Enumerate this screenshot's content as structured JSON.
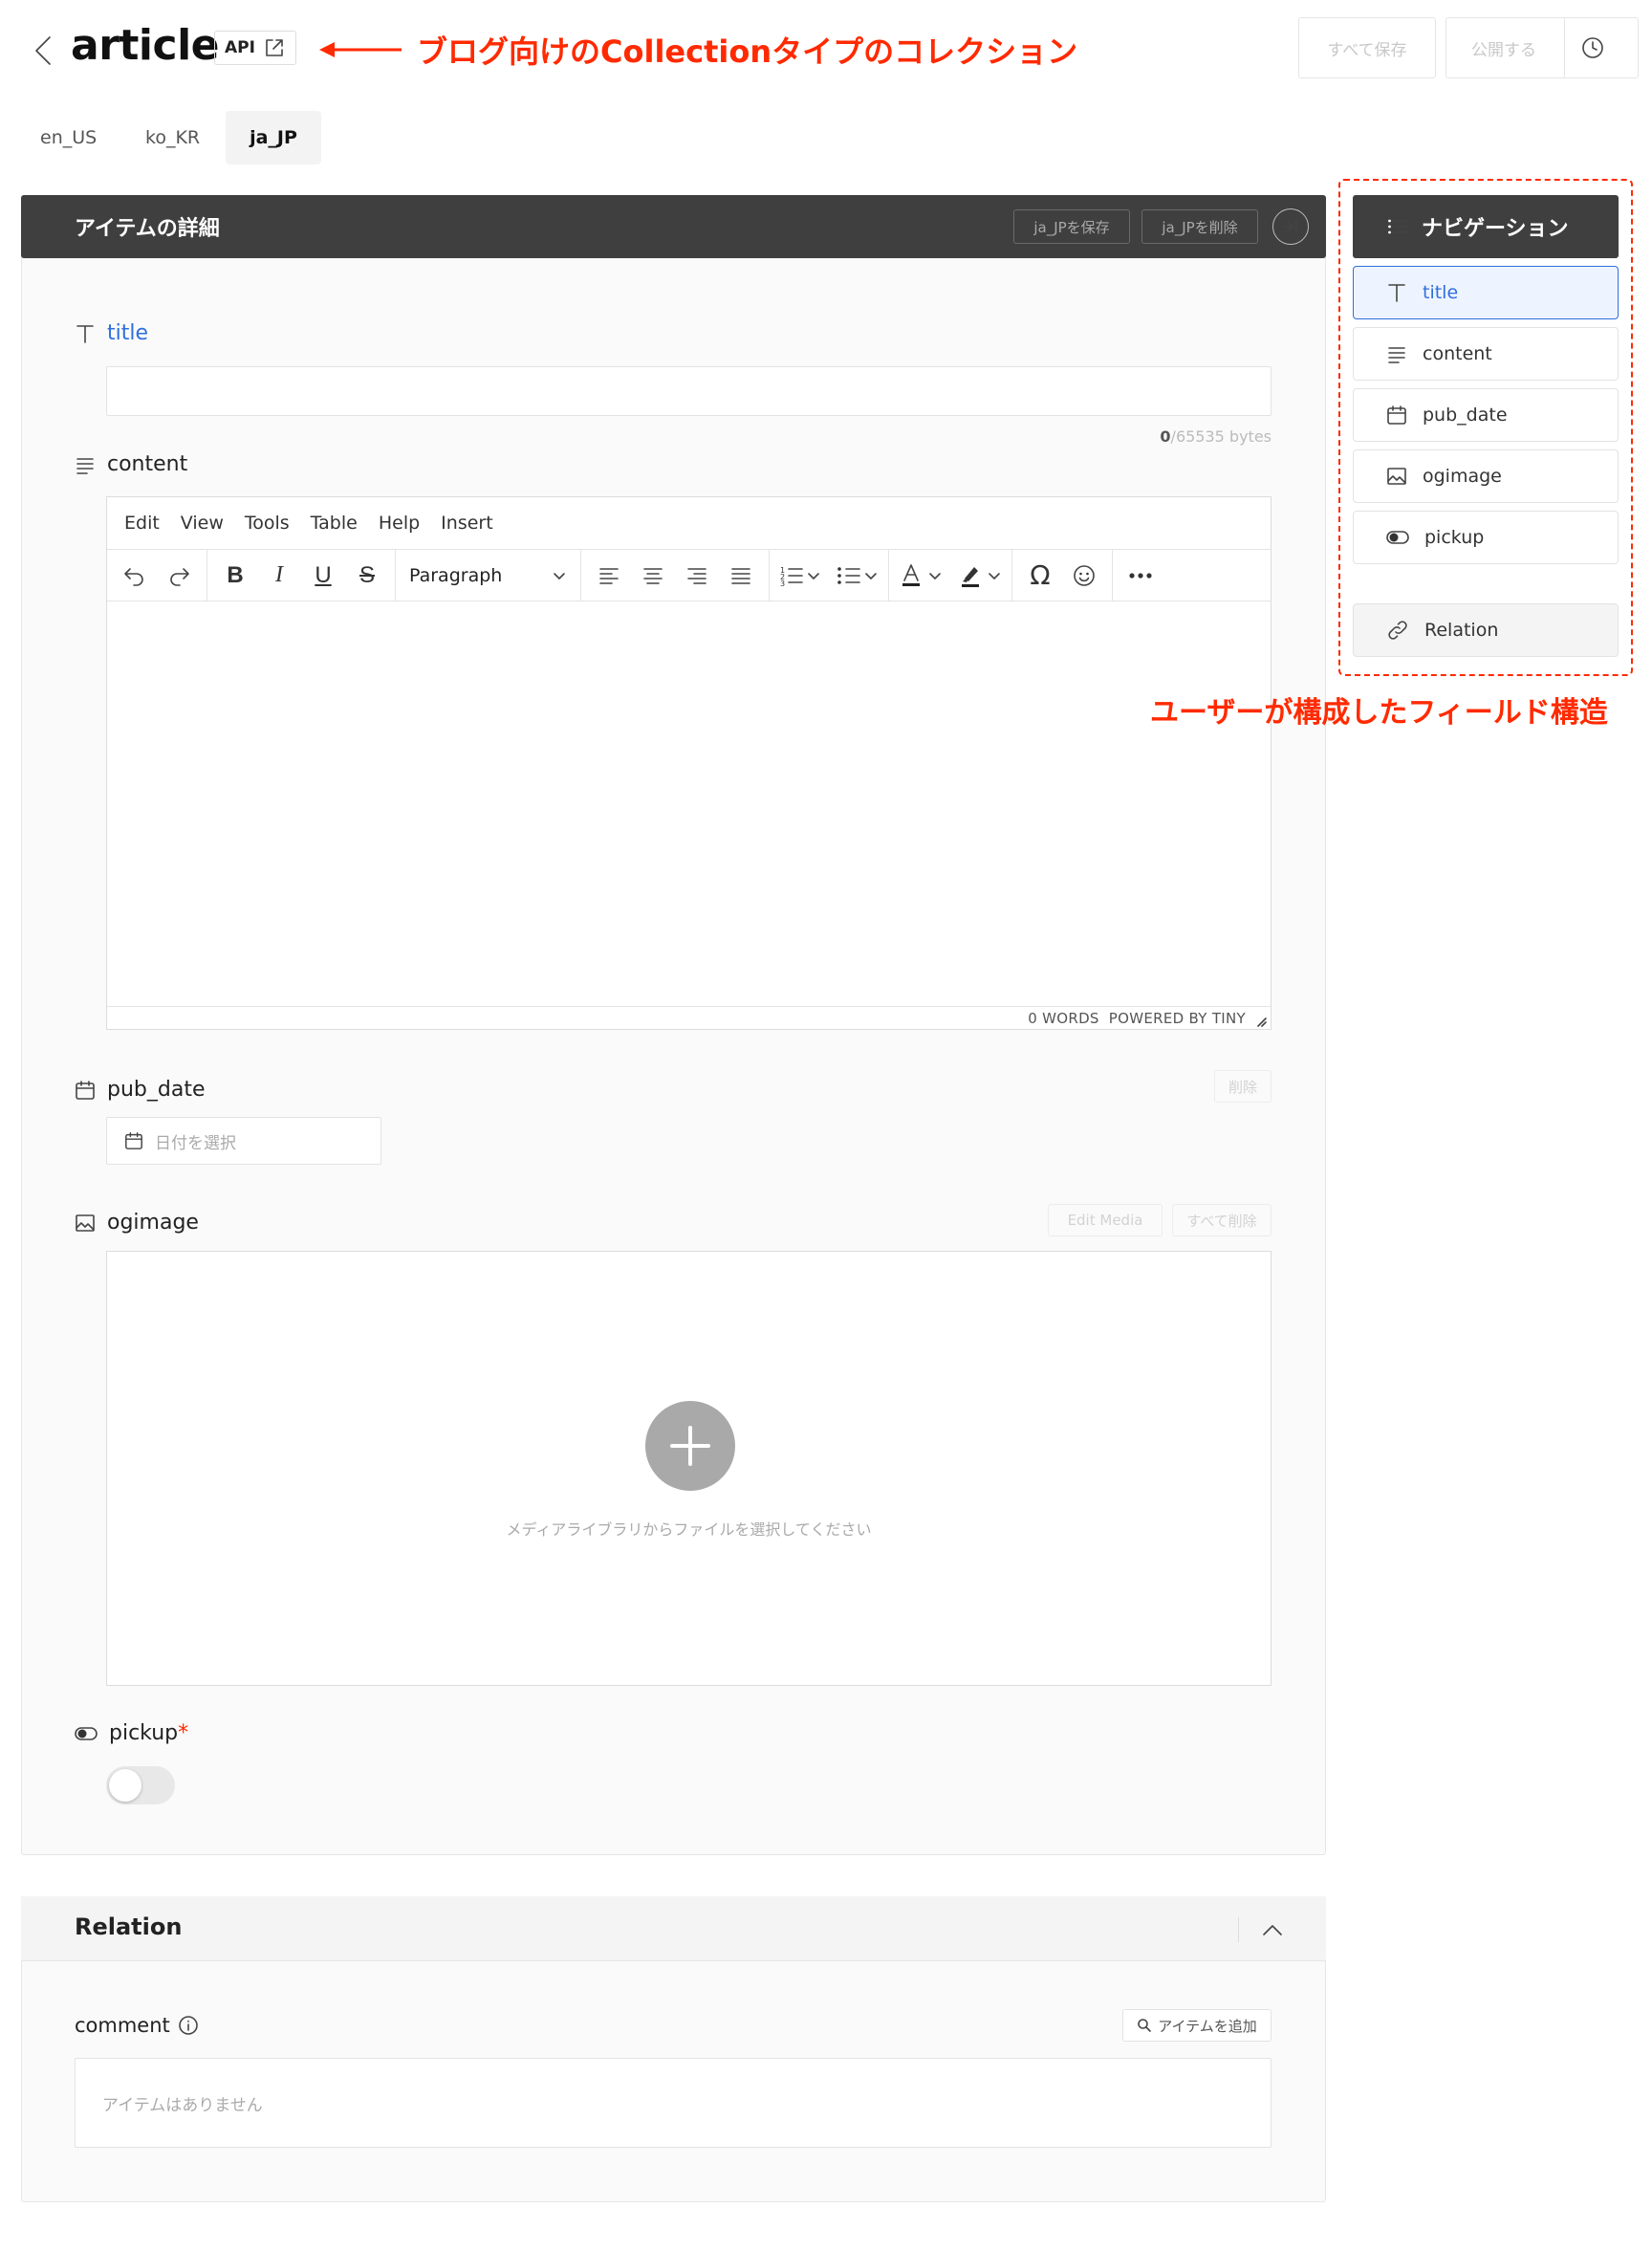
{
  "header": {
    "title": "article",
    "api_label": "API",
    "annotation": "ブログ向けのCollectionタイプのコレクション",
    "save_all": "すべて保存",
    "publish": "公開する"
  },
  "locales": [
    {
      "label": "en_US",
      "active": false
    },
    {
      "label": "ko_KR",
      "active": false
    },
    {
      "label": "ja_JP",
      "active": true
    }
  ],
  "detail": {
    "title": "アイテムの詳細",
    "save_locale": "ja_JPを保存",
    "delete_locale": "ja_JPを削除"
  },
  "fields": {
    "title": {
      "label": "title",
      "value": "",
      "counter_used": "0",
      "counter_limit": "/65535 bytes"
    },
    "content": {
      "label": "content"
    },
    "pub_date": {
      "label": "pub_date",
      "delete": "削除",
      "placeholder": "日付を選択"
    },
    "ogimage": {
      "label": "ogimage",
      "edit_media": "Edit Media",
      "delete_all": "すべて削除",
      "hint": "メディアライブラリからファイルを選択してください"
    },
    "pickup": {
      "label": "pickup",
      "required_mark": "*",
      "value": false
    }
  },
  "editor": {
    "menu": [
      "Edit",
      "View",
      "Tools",
      "Table",
      "Help",
      "Insert"
    ],
    "block_format": "Paragraph",
    "word_count": "0 WORDS",
    "powered_by": "POWERED BY TINY"
  },
  "navigation": {
    "title": "ナビゲーション",
    "items": [
      {
        "label": "title",
        "icon": "text-type-icon",
        "active": true
      },
      {
        "label": "content",
        "icon": "paragraph-icon",
        "active": false
      },
      {
        "label": "pub_date",
        "icon": "calendar-icon",
        "active": false
      },
      {
        "label": "ogimage",
        "icon": "image-icon",
        "active": false
      },
      {
        "label": "pickup",
        "icon": "toggle-icon",
        "active": false
      }
    ],
    "relation": "Relation",
    "annotation": "ユーザーが構成したフィールド構造"
  },
  "relation": {
    "title": "Relation",
    "comment_label": "comment",
    "add_item": "アイテムを追加",
    "empty": "アイテムはありません"
  },
  "colors": {
    "accent": "#2f6fdc",
    "annotation": "#ff2a00",
    "dark_bar": "#3f3f3f"
  }
}
